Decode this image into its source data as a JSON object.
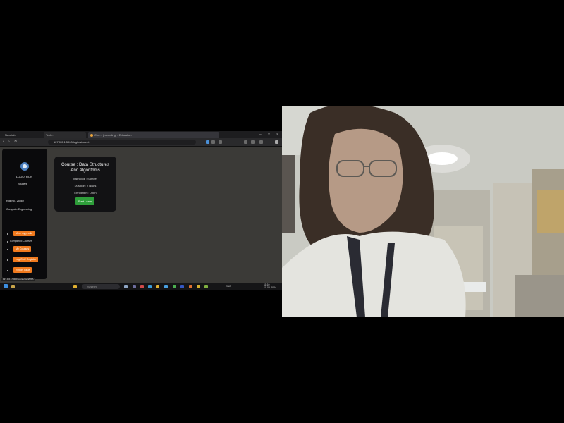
{
  "browser": {
    "tabs": [
      {
        "label": "New tab"
      },
      {
        "label": "Tech..."
      },
      {
        "label": "Cho... (recording) - Education"
      }
    ],
    "window_controls": [
      "–",
      "□",
      "×"
    ],
    "url": "127.0.0.1:5000/login/student",
    "nav": {
      "back": "‹",
      "forward": "›",
      "reload": "↻",
      "home": "⌂"
    }
  },
  "sidebar": {
    "brand": "LOGOTRON",
    "role": "Student",
    "info": [
      "Roll No.: 25569",
      "Computer Engineering"
    ],
    "menu": [
      {
        "label": "View my profile",
        "type": "button"
      },
      {
        "label": "Completed Courses",
        "type": "text"
      },
      {
        "label": "My Courses",
        "type": "button"
      },
      {
        "label": "Log Out / Register",
        "type": "button"
      },
      {
        "label": "Report Issue",
        "type": "button"
      }
    ]
  },
  "card": {
    "title": "Course : Data Structures And Algorithms",
    "lines": [
      "Instructor : Sumeet",
      "Duration: 2 hours",
      "Enrollment: Open"
    ],
    "button": "Start Learn"
  },
  "status_bar": "127.0.0.1:5000/course/start/DSA",
  "taskbar": {
    "search_placeholder": "Search",
    "weather": "26°C",
    "time": "11:10",
    "date": "10-05-2024",
    "lang": "ENG"
  },
  "webcam": {
    "label": "Webcam feed"
  },
  "colors": {
    "accent_orange": "#f07a1e",
    "start_green": "#2e9e3a",
    "card_bg": "#121214",
    "page_bg": "#3b3a37"
  }
}
